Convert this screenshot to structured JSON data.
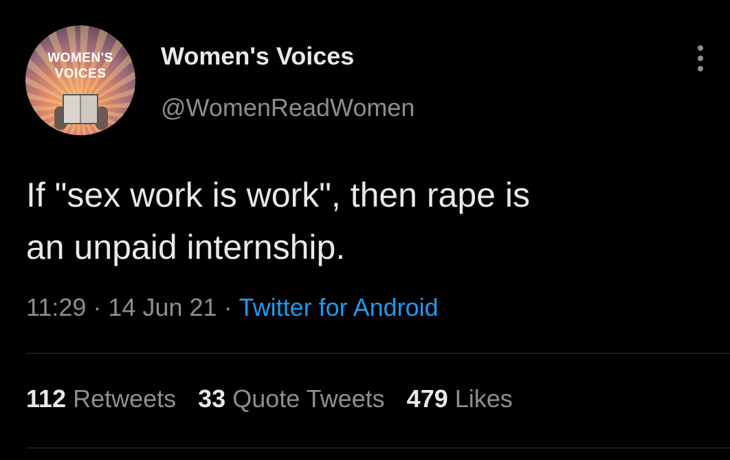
{
  "author": {
    "avatar_text_line1": "WOMEN'S",
    "avatar_text_line2": "VOICES",
    "display_name": "Women's Voices",
    "handle": "@WomenReadWomen"
  },
  "menu": {
    "icon": "more-vertical-icon"
  },
  "tweet": {
    "text_line1": "If \"sex work is work\", then rape is",
    "text_line2": "an unpaid internship.",
    "time": "11:29",
    "separator1": "·",
    "date": "14 Jun 21",
    "separator2": "·",
    "source": "Twitter for Android"
  },
  "stats": {
    "retweets_count": "112",
    "retweets_label": "Retweets",
    "quotes_count": "33",
    "quotes_label": "Quote Tweets",
    "likes_count": "479",
    "likes_label": "Likes"
  },
  "colors": {
    "background": "#000000",
    "primary_text": "#e7e9ea",
    "secondary_text": "#8b8f94",
    "link": "#1d9bf0",
    "divider": "#2f3336"
  }
}
